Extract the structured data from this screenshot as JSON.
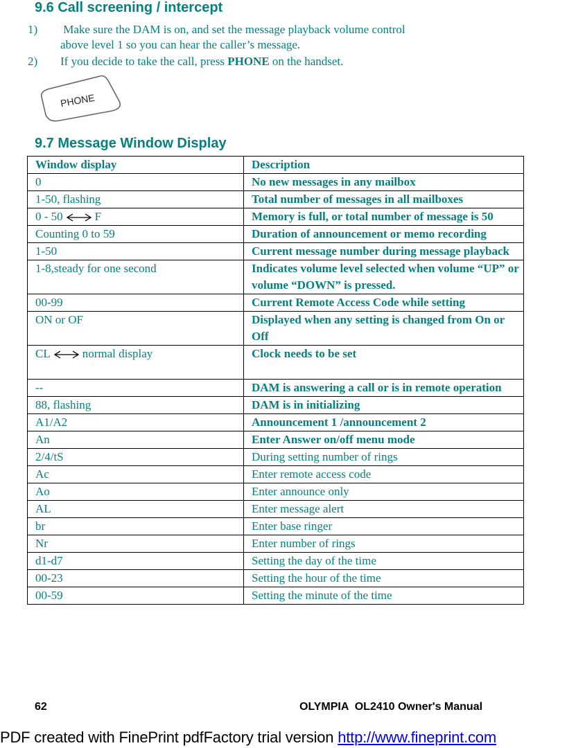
{
  "section_96": {
    "heading": "9.6 Call screening / intercept",
    "steps": [
      {
        "num": "1)",
        "line1": " Make sure the DAM is on, and set the message playback volume control",
        "line2": "above level 1 so you can hear the caller’s message."
      },
      {
        "num": "2)",
        "pre": "If you decide to take the call, press ",
        "bold": "PHONE",
        "post": " on the handset."
      }
    ],
    "button_image_label": "PHONE"
  },
  "section_97": {
    "heading": "9.7 Message Window Display",
    "table": {
      "headers": [
        "Window display",
        "Description"
      ],
      "rows": [
        {
          "display": "0",
          "description": "No new messages in any mailbox",
          "bold": true
        },
        {
          "display": "1-50, flashing",
          "description": "Total number of messages in all mailboxes",
          "bold": true
        },
        {
          "display_left": "0 - 50",
          "display_right": "F",
          "arrow": "double-arrow-icon",
          "description": "Memory is full, or total number of message is 50",
          "bold": true
        },
        {
          "display": "Counting 0 to 59",
          "description": "Duration of announcement or memo recording",
          "bold": true
        },
        {
          "display": "1-50",
          "description": "Current message number during message playback",
          "bold": true
        },
        {
          "display": "1-8,steady for one second",
          "description": "Indicates volume level selected when volume “UP” or volume “DOWN” is pressed.",
          "bold": true
        },
        {
          "display": "00-99",
          "description": "Current Remote Access Code while setting",
          "bold": true
        },
        {
          "display": "ON or OF",
          "description": "Displayed when any setting is changed from On or Off",
          "bold": true
        },
        {
          "display_left": "CL",
          "display_right": "normal display",
          "arrow": "double-arrow-icon",
          "description": "Clock needs to be set",
          "bold": true
        },
        {
          "display": "--",
          "description": "DAM is answering a call or is in remote operation",
          "bold": true
        },
        {
          "display": "88, flashing",
          "description": "DAM is in initializing",
          "bold": true
        },
        {
          "display": "A1/A2",
          "description": "Announcement 1 /announcement 2",
          "bold": true
        },
        {
          "display": "An",
          "description": "Enter Answer on/off menu mode",
          "bold": true
        },
        {
          "display": "2/4/tS",
          "description": "During setting number of rings",
          "bold": false
        },
        {
          "display": "Ac",
          "description": "Enter remote access code",
          "bold": false
        },
        {
          "display": "Ao",
          "description": "Enter announce only",
          "bold": false
        },
        {
          "display": "AL",
          "description": "Enter message alert",
          "bold": false
        },
        {
          "display": "br",
          "description": "Enter base ringer",
          "bold": false
        },
        {
          "display": "Nr",
          "description": "Enter number of rings",
          "bold": false
        },
        {
          "display": "d1-d7",
          "description": "Setting the day of the time",
          "bold": false
        },
        {
          "display": "00-23",
          "description": "Setting the hour of the time",
          "bold": false
        },
        {
          "display": "00-59",
          "description": "Setting the minute of the time",
          "bold": false
        }
      ]
    }
  },
  "footer": {
    "page_number": "62",
    "manual_title": "OLYMPIA  OL2410 Owner's Manual"
  },
  "watermark": {
    "text": "PDF created with FinePrint pdfFactory trial version ",
    "link": "http://www.fineprint.com"
  }
}
